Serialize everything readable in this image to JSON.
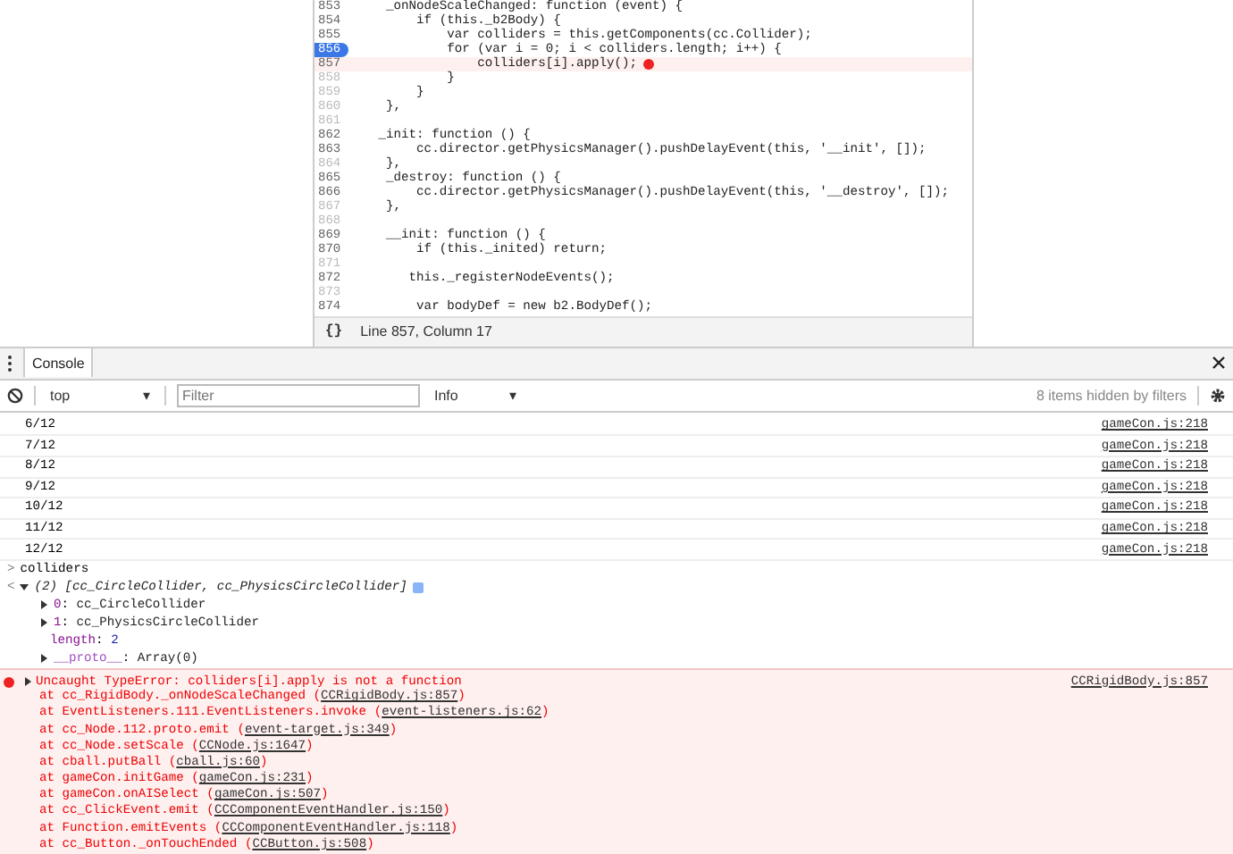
{
  "editor": {
    "lines": [
      {
        "number": "853",
        "code": "    _onNodeScaleChanged: function (event) {",
        "dim": false,
        "breakpoint": false,
        "error": false
      },
      {
        "number": "854",
        "code": "        if (this._b2Body) {",
        "dim": false,
        "breakpoint": false,
        "error": false
      },
      {
        "number": "855",
        "code": "            var colliders = this.getComponents(cc.Collider);",
        "dim": false,
        "breakpoint": false,
        "error": false
      },
      {
        "number": "856",
        "code": "            for (var i = 0; i < colliders.length; i++) {",
        "dim": false,
        "breakpoint": true,
        "error": false
      },
      {
        "number": "857",
        "code": "                colliders[i].apply();",
        "dim": false,
        "breakpoint": false,
        "error": true
      },
      {
        "number": "858",
        "code": "            }",
        "dim": true,
        "breakpoint": false,
        "error": false
      },
      {
        "number": "859",
        "code": "        }",
        "dim": true,
        "breakpoint": false,
        "error": false
      },
      {
        "number": "860",
        "code": "    },",
        "dim": true,
        "breakpoint": false,
        "error": false
      },
      {
        "number": "861",
        "dim": true,
        "breakpoint": false,
        "error": false
      },
      {
        "number": "862",
        "code": "   _init: function () {",
        "dim": false,
        "breakpoint": false,
        "error": false
      },
      {
        "number": "863",
        "code": "        cc.director.getPhysicsManager().pushDelayEvent(this, '__init', []);",
        "dim": false,
        "breakpoint": false,
        "error": false
      },
      {
        "number": "864",
        "code": "    },",
        "dim": true,
        "breakpoint": false,
        "error": false
      },
      {
        "number": "865",
        "code": "    _destroy: function () {",
        "dim": false,
        "breakpoint": false,
        "error": false
      },
      {
        "number": "866",
        "code": "        cc.director.getPhysicsManager().pushDelayEvent(this, '__destroy', []);",
        "dim": false,
        "breakpoint": false,
        "error": false
      },
      {
        "number": "867",
        "code": "    },",
        "dim": true,
        "breakpoint": false,
        "error": false
      },
      {
        "number": "868",
        "dim": true,
        "breakpoint": false,
        "error": false
      },
      {
        "number": "869",
        "code": "    __init: function () {",
        "dim": false,
        "breakpoint": false,
        "error": false
      },
      {
        "number": "870",
        "code": "        if (this._inited) return;",
        "dim": false,
        "breakpoint": false,
        "error": false
      },
      {
        "number": "871",
        "dim": true,
        "breakpoint": false,
        "error": false
      },
      {
        "number": "872",
        "code": "       this._registerNodeEvents();",
        "dim": false,
        "breakpoint": false,
        "error": false
      },
      {
        "number": "873",
        "dim": true,
        "breakpoint": false,
        "error": false
      },
      {
        "number": "874",
        "code": "        var bodyDef = new b2.BodyDef();",
        "dim": false,
        "breakpoint": false,
        "error": false
      }
    ],
    "format_button": "{}",
    "cursor_position": "Line 857, Column 17"
  },
  "drawer": {
    "tabs": [
      {
        "label": "Console",
        "selected": true
      }
    ]
  },
  "toolbar": {
    "context": "top",
    "context_caret": "▾",
    "filter_placeholder": "Filter",
    "level": "Info",
    "level_caret": "▾",
    "hidden_note": "8 items hidden by filters"
  },
  "logs": [
    {
      "text": "6/12",
      "source": "gameCon.js:218"
    },
    {
      "text": "7/12",
      "source": "gameCon.js:218"
    },
    {
      "text": "8/12",
      "source": "gameCon.js:218"
    },
    {
      "text": "9/12",
      "source": "gameCon.js:218"
    },
    {
      "text": "10/12",
      "source": "gameCon.js:218"
    },
    {
      "text": "11/12",
      "source": "gameCon.js:218"
    },
    {
      "text": "12/12",
      "source": "gameCon.js:218"
    }
  ],
  "command": {
    "prompt": ">",
    "input": "colliders",
    "result": {
      "marker": "<",
      "summary": "(2) [cc_CircleCollider, cc_PhysicsCircleCollider]",
      "expanded": true,
      "entries": [
        {
          "key": "0",
          "separator": ":",
          "value": "cc_CircleCollider",
          "kind": "object"
        },
        {
          "key": "1",
          "separator": ":",
          "value": "cc_PhysicsCircleCollider",
          "kind": "object"
        },
        {
          "key": "length",
          "separator": ":",
          "value": "2",
          "kind": "number"
        },
        {
          "key": "__proto__",
          "separator": ":",
          "value": "Array(0)",
          "kind": "proto"
        }
      ]
    }
  },
  "error": {
    "message": "Uncaught TypeError: colliders[i].apply is not a function",
    "source": "CCRigidBody.js:857",
    "stack": [
      {
        "frame": "at cc_RigidBody._onNodeScaleChanged",
        "open": "(",
        "link": "CCRigidBody.js:857",
        "close": ")"
      },
      {
        "frame": "at EventListeners.111.EventListeners.invoke",
        "open": "(",
        "link": "event-listeners.js:62",
        "close": ")"
      },
      {
        "frame": "at cc_Node.112.proto.emit",
        "open": "(",
        "link": "event-target.js:349",
        "close": ")"
      },
      {
        "frame": "at cc_Node.setScale",
        "open": "(",
        "link": "CCNode.js:1647",
        "close": ")"
      },
      {
        "frame": "at cball.putBall",
        "open": "(",
        "link": "cball.js:60",
        "close": ")"
      },
      {
        "frame": "at gameCon.initGame",
        "open": "(",
        "link": "gameCon.js:231",
        "close": ")"
      },
      {
        "frame": "at gameCon.onAISelect",
        "open": "(",
        "link": "gameCon.js:507",
        "close": ")"
      },
      {
        "frame": "at cc_ClickEvent.emit",
        "open": "(",
        "link": "CCComponentEventHandler.js:150",
        "close": ")"
      },
      {
        "frame": "at Function.emitEvents",
        "open": "(",
        "link": "CCComponentEventHandler.js:118",
        "close": ")"
      },
      {
        "frame": "at cc_Button._onTouchEnded",
        "open": "(",
        "link": "CCButton.js:508",
        "close": ")"
      }
    ]
  }
}
